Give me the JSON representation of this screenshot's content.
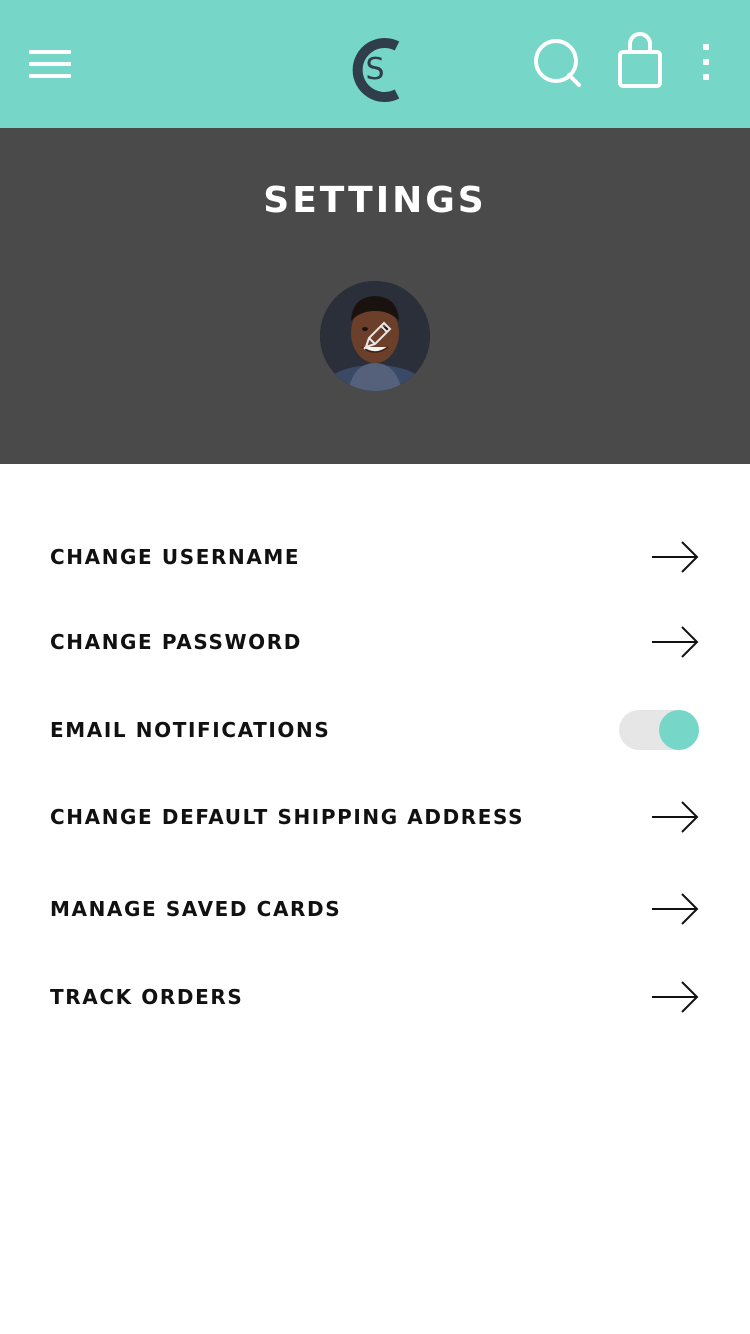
{
  "theme": {
    "accent": "#76d7c9",
    "header_dark": "#4a4a4a",
    "logo_color": "#2f3e4a",
    "text": "#111111",
    "toggle_track": "#e6e6e6"
  },
  "topbar": {
    "menu_icon": "hamburger-menu-icon",
    "logo_letter": "S",
    "search_icon": "search-icon",
    "bag_icon": "shopping-bag-icon",
    "more_icon": "more-vertical-icon"
  },
  "header": {
    "title": "SETTINGS",
    "avatar_edit_icon": "pencil-icon"
  },
  "settings": {
    "items": [
      {
        "label": "CHANGE USERNAME",
        "control": "arrow"
      },
      {
        "label": "CHANGE PASSWORD",
        "control": "arrow"
      },
      {
        "label": "EMAIL NOTIFICATIONS",
        "control": "toggle",
        "enabled": true
      },
      {
        "label": "CHANGE DEFAULT SHIPPING ADDRESS",
        "control": "arrow"
      },
      {
        "label": "MANAGE SAVED CARDS",
        "control": "arrow"
      },
      {
        "label": "TRACK ORDERS",
        "control": "arrow"
      }
    ]
  }
}
